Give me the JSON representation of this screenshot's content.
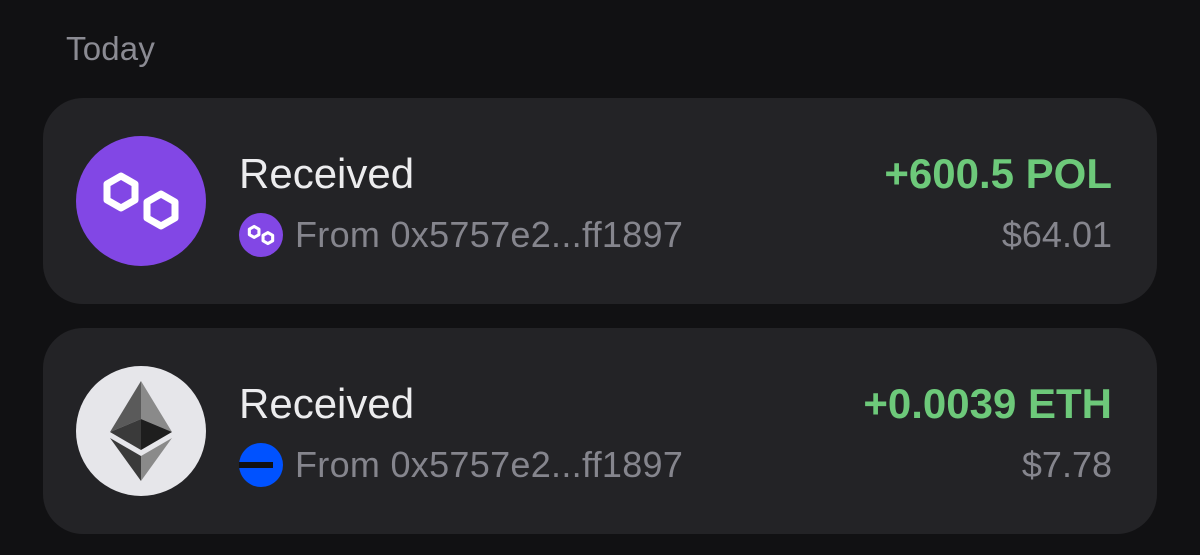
{
  "section": {
    "label": "Today"
  },
  "transactions": [
    {
      "title": "Received",
      "from": "From 0x5757e2...ff1897",
      "amount": "+600.5 POL",
      "fiat": "$64.01",
      "token_icon": "polygon-icon",
      "chain_badge": "polygon-chain-icon",
      "icon_color": "#8247e5"
    },
    {
      "title": "Received",
      "from": "From 0x5757e2...ff1897",
      "amount": "+0.0039 ETH",
      "fiat": "$7.78",
      "token_icon": "ethereum-icon",
      "chain_badge": "base-chain-icon",
      "icon_color": "#e6e6ea"
    }
  ],
  "colors": {
    "background": "#111113",
    "card": "#232326",
    "positive_amount": "#6dc97a",
    "secondary_text": "#85858d",
    "polygon_purple": "#8247e5",
    "base_blue": "#0052ff"
  }
}
